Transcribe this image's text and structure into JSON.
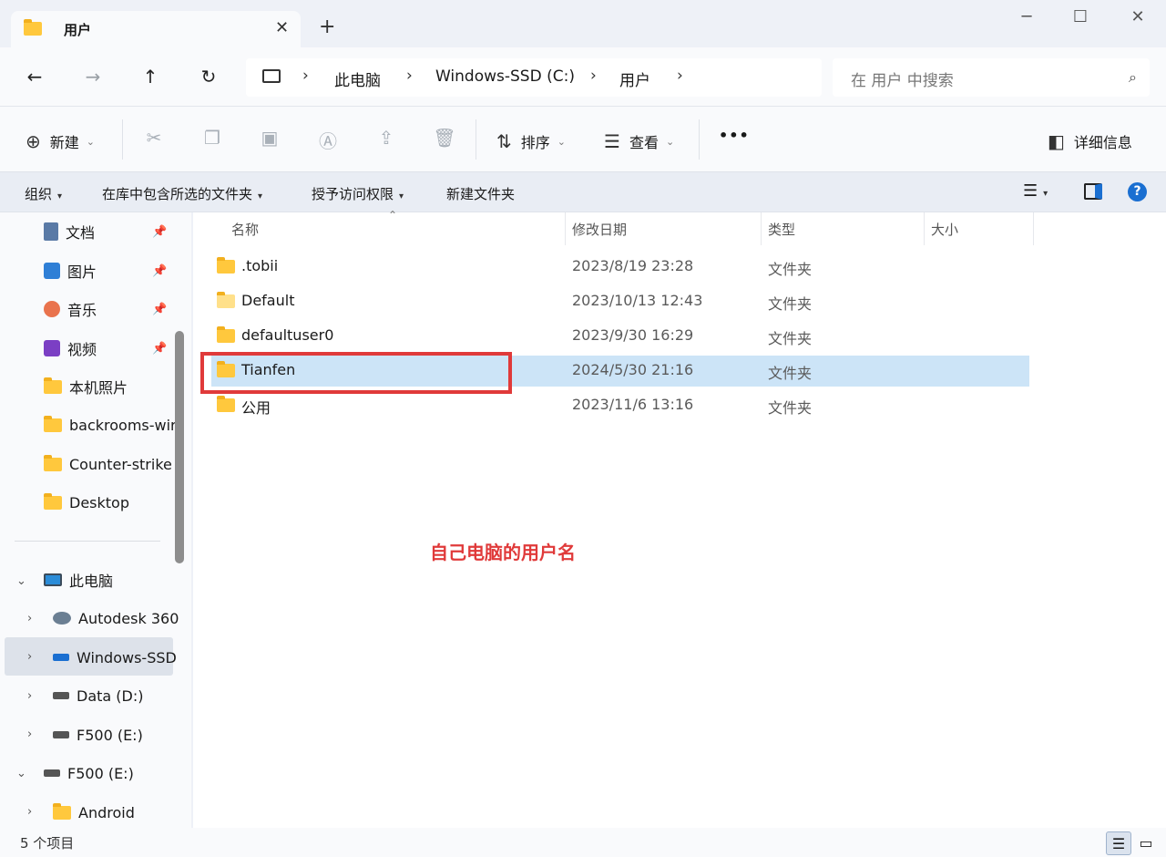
{
  "window": {
    "tab_title": "用户",
    "close_glyph": "✕",
    "new_tab_glyph": "+",
    "minimize_glyph": "─",
    "maximize_glyph": "☐",
    "close_window_glyph": "✕"
  },
  "nav": {
    "back_glyph": "←",
    "forward_glyph": "→",
    "up_glyph": "↑",
    "refresh_glyph": "↻"
  },
  "breadcrumb": [
    "此电脑",
    "Windows-SSD (C:)",
    "用户"
  ],
  "breadcrumb_sep": "›",
  "search": {
    "placeholder": "在 用户 中搜索"
  },
  "commandbar": {
    "new_label": "新建",
    "sort_label": "排序",
    "view_label": "查看",
    "more_glyph": "•••",
    "details_label": "详细信息"
  },
  "menubar": {
    "organize": "组织",
    "include_in_library": "在库中包含所选的文件夹",
    "grant_access": "授予访问权限",
    "new_folder": "新建文件夹"
  },
  "sidebar": {
    "quick": [
      {
        "label": "文档",
        "icon": "document-icon",
        "pinned": true
      },
      {
        "label": "图片",
        "icon": "picture-icon",
        "pinned": true
      },
      {
        "label": "音乐",
        "icon": "music-icon",
        "pinned": true
      },
      {
        "label": "视频",
        "icon": "video-icon",
        "pinned": true
      },
      {
        "label": "本机照片",
        "icon": "folder-icon",
        "pinned": false
      },
      {
        "label": "backrooms-wir",
        "icon": "folder-icon",
        "pinned": false
      },
      {
        "label": "Counter-strike",
        "icon": "folder-icon",
        "pinned": false
      },
      {
        "label": "Desktop",
        "icon": "folder-icon",
        "pinned": false
      }
    ],
    "this_pc": "此电脑",
    "drives": [
      {
        "label": "Autodesk 360",
        "icon": "cloud-icon"
      },
      {
        "label": "Windows-SSD",
        "icon": "windows-drive-icon"
      },
      {
        "label": "Data (D:)",
        "icon": "drive-icon"
      },
      {
        "label": "F500 (E:)",
        "icon": "drive-icon"
      }
    ],
    "external": "F500 (E:)",
    "external_children": [
      {
        "label": "Android",
        "icon": "folder-icon"
      }
    ]
  },
  "columns": {
    "name": "名称",
    "modified": "修改日期",
    "type": "类型",
    "size": "大小"
  },
  "files": [
    {
      "name": ".tobii",
      "modified": "2023/8/19 23:28",
      "type": "文件夹",
      "size": ""
    },
    {
      "name": "Default",
      "modified": "2023/10/13 12:43",
      "type": "文件夹",
      "size": ""
    },
    {
      "name": "defaultuser0",
      "modified": "2023/9/30 16:29",
      "type": "文件夹",
      "size": ""
    },
    {
      "name": "Tianfen",
      "modified": "2024/5/30 21:16",
      "type": "文件夹",
      "size": "",
      "selected": true
    },
    {
      "name": "公用",
      "modified": "2023/11/6 13:16",
      "type": "文件夹",
      "size": ""
    }
  ],
  "annotation": "自己电脑的用户名",
  "annotation_color": "#e03a3a",
  "status": {
    "item_count": "5 个项目"
  },
  "colors": {
    "selection": "#cce4f7",
    "accent": "#0067c0",
    "folder": "#ffc83d"
  }
}
